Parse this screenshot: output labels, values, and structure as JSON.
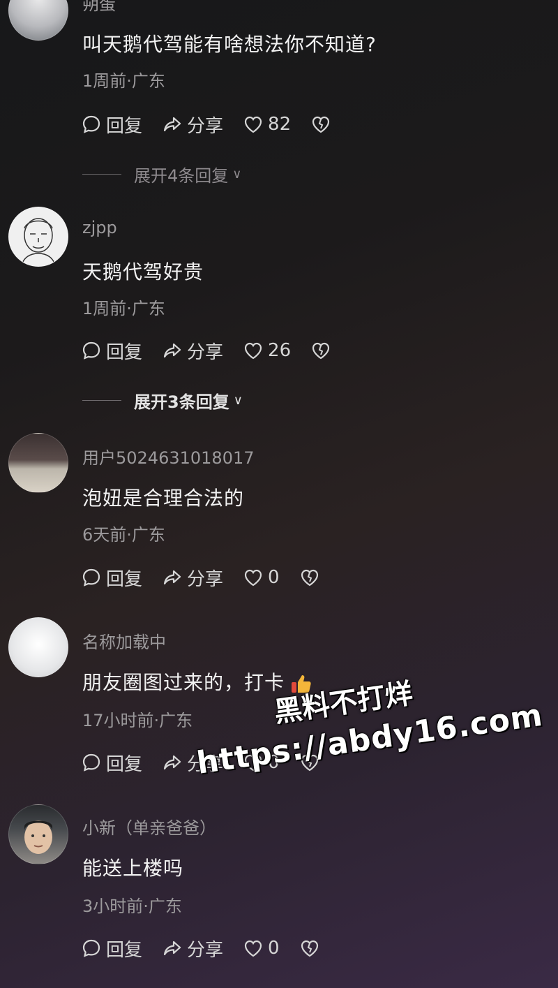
{
  "comments": [
    {
      "username": "朔蛋",
      "text": "叫天鹅代驾能有啥想法你不知道?",
      "meta": "1周前·广东",
      "reply_label": "回复",
      "share_label": "分享",
      "likes": "82",
      "expand_label": "展开4条回复"
    },
    {
      "username": "zjpp",
      "text": "天鹅代驾好贵",
      "meta": "1周前·广东",
      "reply_label": "回复",
      "share_label": "分享",
      "likes": "26",
      "expand_label": "展开3条回复"
    },
    {
      "username": "用户5024631018017",
      "text": "泡妞是合理合法的",
      "meta": "6天前·广东",
      "reply_label": "回复",
      "share_label": "分享",
      "likes": "0"
    },
    {
      "username": "名称加载中",
      "text": "朋友圈图过来的，打卡",
      "emoji": "thumbs-up",
      "meta": "17小时前·广东",
      "reply_label": "回复",
      "share_label": "分享",
      "likes": "0"
    },
    {
      "username": "小新（单亲爸爸）",
      "text": "能送上楼吗",
      "meta": "3小时前·广东",
      "reply_label": "回复",
      "share_label": "分享",
      "likes": "0"
    }
  ],
  "watermark": {
    "line1": "黑料不打烊",
    "line2": "https://abdy16.com"
  },
  "icons": {
    "reply": "comment-bubble-icon",
    "share": "share-arrow-icon",
    "like": "heart-icon",
    "dislike": "broken-heart-icon",
    "expand": "chevron-down-icon"
  },
  "colors": {
    "text_primary": "#f2f2f2",
    "text_secondary": "#9c9a9c",
    "emoji_thumb": "#f4b63a"
  }
}
